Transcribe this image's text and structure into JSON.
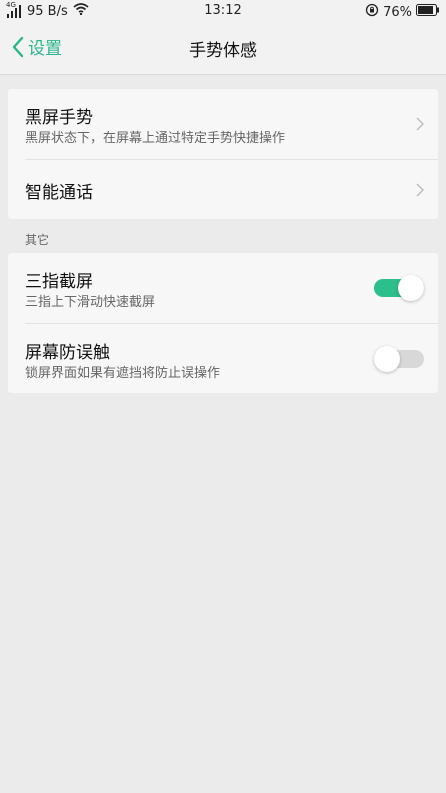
{
  "status_bar": {
    "network_type": "4G",
    "speed": "95 B/s",
    "time": "13:12",
    "battery": "76%"
  },
  "header": {
    "back_label": "设置",
    "title": "手势体感"
  },
  "gestures_card": {
    "items": [
      {
        "title": "黑屏手势",
        "subtitle": "黑屏状态下，在屏幕上通过特定手势快捷操作"
      },
      {
        "title": "智能通话"
      }
    ]
  },
  "other_section": {
    "label": "其它",
    "items": [
      {
        "title": "三指截屏",
        "subtitle": "三指上下滑动快速截屏",
        "toggle": "on"
      },
      {
        "title": "屏幕防误触",
        "subtitle": "锁屏界面如果有遮挡将防止误操作",
        "toggle": "off"
      }
    ]
  },
  "colors": {
    "accent": "#2bb58a",
    "toggle_on": "#2bbf8c",
    "toggle_off": "#d8d8d8",
    "background": "#ebebeb",
    "card": "#f7f7f7"
  }
}
